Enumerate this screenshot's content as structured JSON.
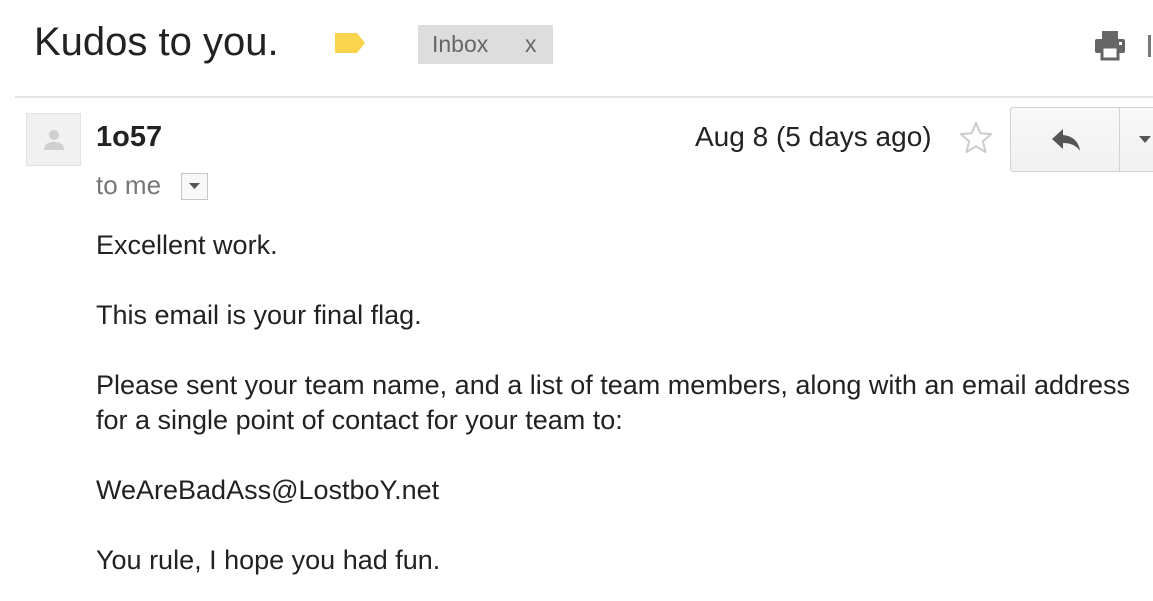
{
  "header": {
    "subject": "Kudos to you.",
    "label_icon": "label-tag-icon",
    "label_color": "#f9d44c",
    "inbox_label": "Inbox",
    "remove_label": "x",
    "print_icon": "print-icon"
  },
  "message": {
    "sender": "1o57",
    "recipient": "to me",
    "timestamp": "Aug 8 (5 days ago)",
    "star_icon": "star-icon",
    "reply_icon": "reply-icon",
    "more_icon": "chevron-down-icon",
    "body": [
      "Excellent work.",
      "This email is your final flag.",
      "Please sent your team name, and a list of team members, along with an email address for a single point of contact for your team to:",
      "WeAreBadAss@LostboY.net",
      "You rule, I hope you had fun."
    ]
  }
}
